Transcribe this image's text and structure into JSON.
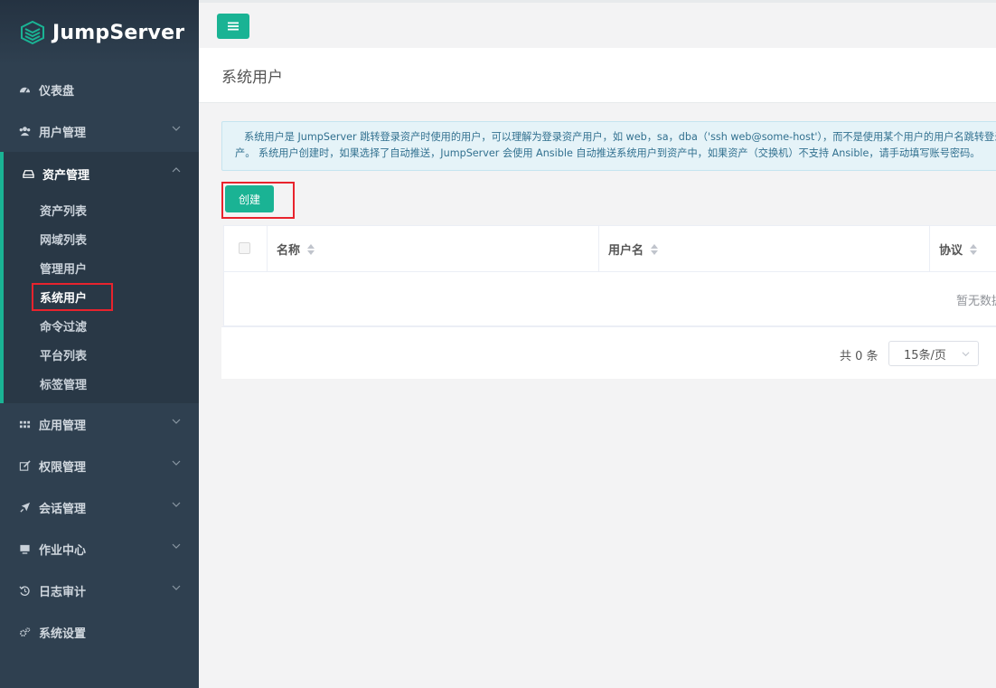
{
  "sidebar": {
    "logo_text": "JumpServer",
    "items_top": [
      {
        "label": "仪表盘",
        "icon": "dashboard-icon"
      },
      {
        "label": "用户管理",
        "icon": "users-icon",
        "has_chevron": true
      }
    ],
    "open_group": {
      "label": "资产管理",
      "icon": "hdd-icon",
      "sub_items": [
        "资产列表",
        "网域列表",
        "管理用户",
        "系统用户",
        "命令过滤",
        "平台列表",
        "标签管理"
      ],
      "active": "系统用户"
    },
    "items_bottom": [
      {
        "label": "应用管理",
        "icon": "grid-icon"
      },
      {
        "label": "权限管理",
        "icon": "edit-icon"
      },
      {
        "label": "会话管理",
        "icon": "rocket-icon"
      },
      {
        "label": "作业中心",
        "icon": "desktop-icon"
      },
      {
        "label": "日志审计",
        "icon": "history-icon"
      },
      {
        "label": "系统设置",
        "icon": "gears-icon"
      }
    ]
  },
  "page": {
    "title": "系统用户"
  },
  "alert": {
    "line1": "系统用户是 JumpServer 跳转登录资产时使用的用户，可以理解为登录资产用户，如 web，sa，dba（'ssh web@some-host'），而不是使用某个用户的用户名跳转登录服务器（'ssh xiaoming@some-host'）；简单来说是用户使用自己的用户名登录 JumpServer，JumpServer 使用系统用户登录资",
    "line2": "产。 系统用户创建时，如果选择了自动推送，JumpServer 会使用 Ansible 自动推送系统用户到资产中，如果资产（交换机）不支持 Ansible，请手动填写账号密码。"
  },
  "toolbar": {
    "create_label": "创建"
  },
  "table": {
    "columns": [
      "名称",
      "用户名",
      "协议"
    ],
    "empty_text": "暂无数据"
  },
  "pagination": {
    "total_text": "共 0 条",
    "page_size": "15条/页"
  },
  "colors": {
    "sidebar_bg": "#2f4050",
    "accent": "#1ab394",
    "highlight_box": "#e8232d"
  }
}
